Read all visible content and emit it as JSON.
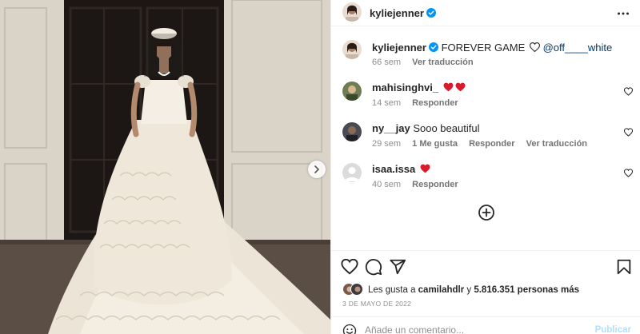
{
  "post": {
    "image_alt": "",
    "next_icon": "chevron-right-icon"
  },
  "header": {
    "username": "kyliejenner",
    "verified_icon": "verified-badge-icon",
    "more_icon": "more-icon"
  },
  "caption": {
    "username": "kyliejenner",
    "text": "FOREVER GAME",
    "icon": "heart-outline-icon",
    "mention": "@off____white",
    "time": "66 sem",
    "translate": "Ver traducción"
  },
  "comments": [
    {
      "username": "mahisinghvi_",
      "text": "",
      "hearts": 2,
      "time": "14 sem",
      "likes": "",
      "reply": "Responder",
      "translate": ""
    },
    {
      "username": "ny__jay",
      "text": "Sooo beautiful",
      "hearts": 0,
      "time": "29 sem",
      "likes": "1 Me gusta",
      "reply": "Responder",
      "translate": "Ver traducción"
    },
    {
      "username": "isaa.issa",
      "text": "",
      "hearts": 1,
      "time": "40 sem",
      "likes": "",
      "reply": "Responder",
      "translate": ""
    }
  ],
  "load_more_icon": "plus-circle-icon",
  "actions": {
    "like_icon": "heart-icon",
    "comment_icon": "comment-icon",
    "share_icon": "send-icon",
    "save_icon": "bookmark-icon"
  },
  "likes": {
    "prefix": "Les gusta a ",
    "user": "camilahdlr",
    "middle": " y ",
    "count": "5.816.351 personas más"
  },
  "date": "3 DE MAYO DE 2022",
  "comment_box": {
    "placeholder": "Añade un comentario...",
    "publish": "Publicar",
    "emoji_icon": "emoji-icon"
  },
  "colors": {
    "text": "#262626",
    "muted": "#8e8e8e",
    "link": "#00376b",
    "verified": "#0095f6",
    "heart_red": "#ed4956",
    "publish_disabled": "#b2dffc"
  }
}
